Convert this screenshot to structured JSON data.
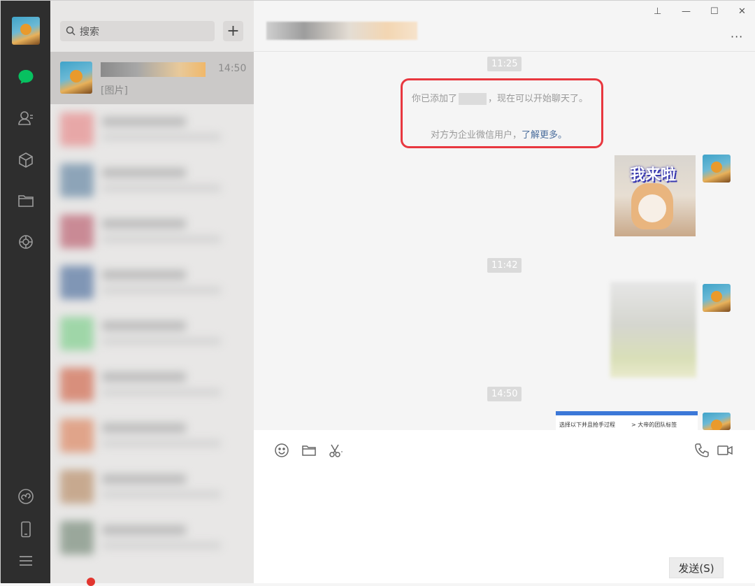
{
  "search": {
    "placeholder": "搜索",
    "add_label": "+"
  },
  "active_chat": {
    "time": "14:50",
    "preview": "[图片]"
  },
  "window": {
    "pin": "⊥",
    "minimize": "—",
    "maximize": "☐",
    "close": "✕",
    "more": "···"
  },
  "messages": {
    "time1": "11:25",
    "system_line1_prefix": "你已添加了",
    "system_line1_suffix": "，现在可以开始聊天了。",
    "system_line2_prefix": "对方为企业微信用户，",
    "system_line2_link": "了解更多。",
    "sticker_caption": "我来啦",
    "time2": "11:42",
    "time3": "14:50",
    "doc_left": "选择以下并且抢手过程",
    "doc_right": "> 大帝的团队标签"
  },
  "input": {
    "send_label": "发送(S)"
  },
  "colors": {
    "accent_green": "#07c160",
    "highlight_red": "#e8373f",
    "link_blue": "#4a6d9c"
  }
}
